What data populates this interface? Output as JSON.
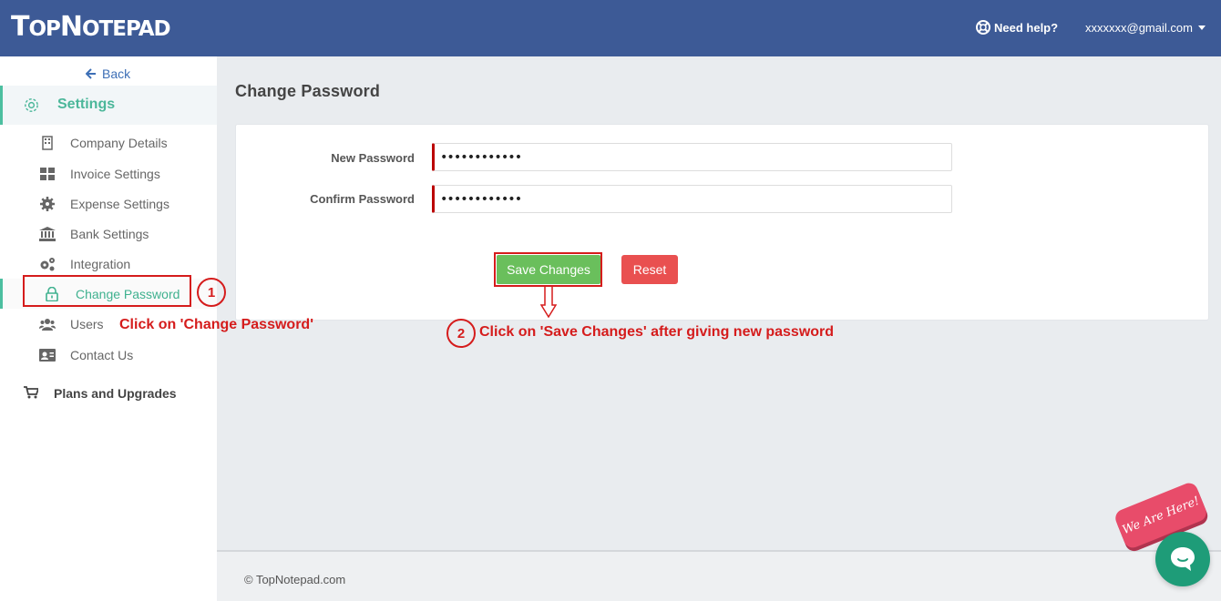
{
  "header": {
    "logo_big_t": "T",
    "logo_op": "OP",
    "logo_big_n": "N",
    "logo_otepad": "OTEPAD",
    "help_label": "Need help?",
    "account_email": "xxxxxxx@gmail.com",
    "bg_color": "#3d5a96"
  },
  "sidebar": {
    "back_label": "Back",
    "settings_label": "Settings",
    "items": [
      {
        "label": "Company Details",
        "icon": "building-icon"
      },
      {
        "label": "Invoice Settings",
        "icon": "grid-icon"
      },
      {
        "label": "Expense Settings",
        "icon": "gear-icon"
      },
      {
        "label": "Bank Settings",
        "icon": "bank-icon"
      },
      {
        "label": "Integration",
        "icon": "gears-icon"
      },
      {
        "label": "Change Password",
        "icon": "lock-icon",
        "active": true
      },
      {
        "label": "Users",
        "icon": "users-icon"
      },
      {
        "label": "Contact Us",
        "icon": "contact-card-icon"
      }
    ],
    "plans_label": "Plans and Upgrades",
    "accent_color": "#4cbfa0"
  },
  "main": {
    "title": "Change Password",
    "form": {
      "new_password_label": "New Password",
      "new_password_value": "••••••••••••",
      "confirm_password_label": "Confirm Password",
      "confirm_password_value": "••••••••••••"
    },
    "save_label": "Save Changes",
    "reset_label": "Reset"
  },
  "annotations": {
    "step1_number": "1",
    "step1_text": "Click on 'Change Password'",
    "step2_number": "2",
    "step2_text": "Click on 'Save Changes' after giving new password",
    "color": "#d51c1c"
  },
  "footer": {
    "copyright": "© TopNotepad.com"
  },
  "chat": {
    "badge_text": "We Are Here!"
  }
}
